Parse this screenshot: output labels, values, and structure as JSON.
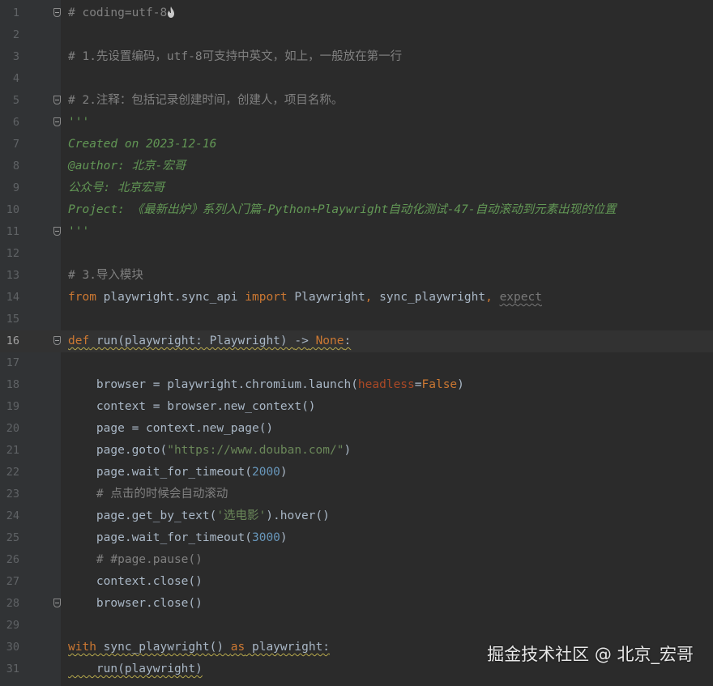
{
  "editor": {
    "lines": [
      {
        "n": "1",
        "segs": [
          [
            "cmt",
            "# coding=utf-8"
          ]
        ],
        "fold": "start",
        "icon": true
      },
      {
        "n": "2",
        "segs": []
      },
      {
        "n": "3",
        "segs": [
          [
            "cmt",
            "# 1.先设置编码，utf-8可支持中英文，如上，一般放在第一行"
          ]
        ]
      },
      {
        "n": "4",
        "segs": []
      },
      {
        "n": "5",
        "segs": [
          [
            "cmt",
            "# 2.注释：包括记录创建时间，创建人，项目名称。"
          ]
        ],
        "fold": "end"
      },
      {
        "n": "6",
        "segs": [
          [
            "doc",
            "'''"
          ]
        ],
        "fold": "start"
      },
      {
        "n": "7",
        "segs": [
          [
            "doc",
            "Created on 2023-12-16"
          ]
        ]
      },
      {
        "n": "8",
        "segs": [
          [
            "doc",
            "@author: 北京-宏哥"
          ]
        ]
      },
      {
        "n": "9",
        "segs": [
          [
            "doc",
            "公众号: 北京宏哥"
          ]
        ]
      },
      {
        "n": "10",
        "segs": [
          [
            "doc",
            "Project: 《最新出炉》系列入门篇-Python+Playwright自动化测试-47-自动滚动到元素出现的位置"
          ]
        ]
      },
      {
        "n": "11",
        "segs": [
          [
            "doc",
            "'''"
          ]
        ],
        "fold": "end"
      },
      {
        "n": "12",
        "segs": []
      },
      {
        "n": "13",
        "segs": [
          [
            "cmt",
            "# 3.导入模块"
          ]
        ]
      },
      {
        "n": "14",
        "segs": [
          [
            "kw",
            "from"
          ],
          [
            "fn",
            " playwright.sync_api "
          ],
          [
            "kw",
            "import"
          ],
          [
            "fn",
            " Playwright"
          ],
          [
            "punc",
            ","
          ],
          [
            "fn",
            " sync_playwright"
          ],
          [
            "punc",
            ","
          ],
          [
            "fn",
            " "
          ],
          [
            "unused",
            "expect"
          ]
        ]
      },
      {
        "n": "15",
        "segs": []
      },
      {
        "n": "16",
        "segs": [
          [
            "kw sq",
            "def"
          ],
          [
            "fn sq",
            " run(playwright: Playwright) "
          ],
          [
            "fn sq",
            "->"
          ],
          [
            "kw sq",
            " None"
          ],
          [
            "fn sq",
            ":"
          ]
        ],
        "fold": "start",
        "current": true
      },
      {
        "n": "17",
        "segs": []
      },
      {
        "n": "18",
        "segs": [
          [
            "fn",
            "    browser = playwright.chromium.launch("
          ],
          [
            "par",
            "headless"
          ],
          [
            "fn",
            "="
          ],
          [
            "kw",
            "False"
          ],
          [
            "fn",
            ")"
          ]
        ]
      },
      {
        "n": "19",
        "segs": [
          [
            "fn",
            "    context = browser.new_context()"
          ]
        ]
      },
      {
        "n": "20",
        "segs": [
          [
            "fn",
            "    page = context.new_page()"
          ]
        ]
      },
      {
        "n": "21",
        "segs": [
          [
            "fn",
            "    page.goto("
          ],
          [
            "str",
            "\"https://www.douban.com/\""
          ],
          [
            "fn",
            ")"
          ]
        ]
      },
      {
        "n": "22",
        "segs": [
          [
            "fn",
            "    page.wait_for_timeout("
          ],
          [
            "num",
            "2000"
          ],
          [
            "fn",
            ")"
          ]
        ]
      },
      {
        "n": "23",
        "segs": [
          [
            "cmt",
            "    # 点击的时候会自动滚动"
          ]
        ]
      },
      {
        "n": "24",
        "segs": [
          [
            "fn",
            "    page.get_by_text("
          ],
          [
            "str",
            "'选电影'"
          ],
          [
            "fn",
            ").hover()"
          ]
        ]
      },
      {
        "n": "25",
        "segs": [
          [
            "fn",
            "    page.wait_for_timeout("
          ],
          [
            "num",
            "3000"
          ],
          [
            "fn",
            ")"
          ]
        ]
      },
      {
        "n": "26",
        "segs": [
          [
            "cmt",
            "    # #page.pause()"
          ]
        ]
      },
      {
        "n": "27",
        "segs": [
          [
            "fn",
            "    context.close()"
          ]
        ]
      },
      {
        "n": "28",
        "segs": [
          [
            "fn",
            "    browser.close()"
          ]
        ],
        "fold": "end"
      },
      {
        "n": "29",
        "segs": []
      },
      {
        "n": "30",
        "segs": [
          [
            "kw sq",
            "with"
          ],
          [
            "fn sq",
            " sync_playwright() "
          ],
          [
            "kw sq",
            "as"
          ],
          [
            "fn sq",
            " playwright:"
          ]
        ]
      },
      {
        "n": "31",
        "segs": [
          [
            "fn sq",
            "    run(playwright)"
          ]
        ]
      }
    ]
  },
  "watermark": {
    "text": "掘金技术社区 @ 北京_宏哥"
  },
  "colors": {
    "background": "#2b2b2b",
    "gutter": "#313335",
    "keyword": "#cc7832",
    "string": "#6a8759",
    "number": "#6897bb",
    "comment": "#808080",
    "docstring": "#629755",
    "parameter": "#aa4926",
    "default_text": "#a9b7c6"
  }
}
